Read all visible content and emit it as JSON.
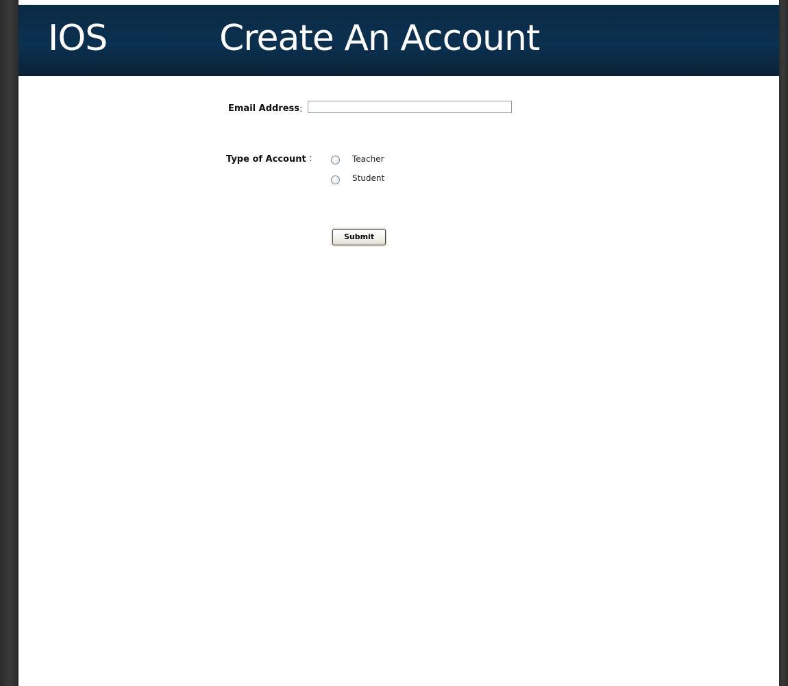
{
  "header": {
    "app_name": "IOS",
    "title": "Create An Account"
  },
  "form": {
    "email": {
      "label": "Email Address",
      "colon": ":",
      "value": "",
      "placeholder": ""
    },
    "account_type": {
      "label": "Type of Account",
      "colon": ":",
      "options": [
        {
          "label": "Teacher",
          "selected": false
        },
        {
          "label": "Student",
          "selected": false
        }
      ]
    },
    "submit_label": "Submit"
  },
  "colors": {
    "header_bg": "#0b3150",
    "header_text": "#ffffff",
    "page_bg": "#ffffff"
  }
}
